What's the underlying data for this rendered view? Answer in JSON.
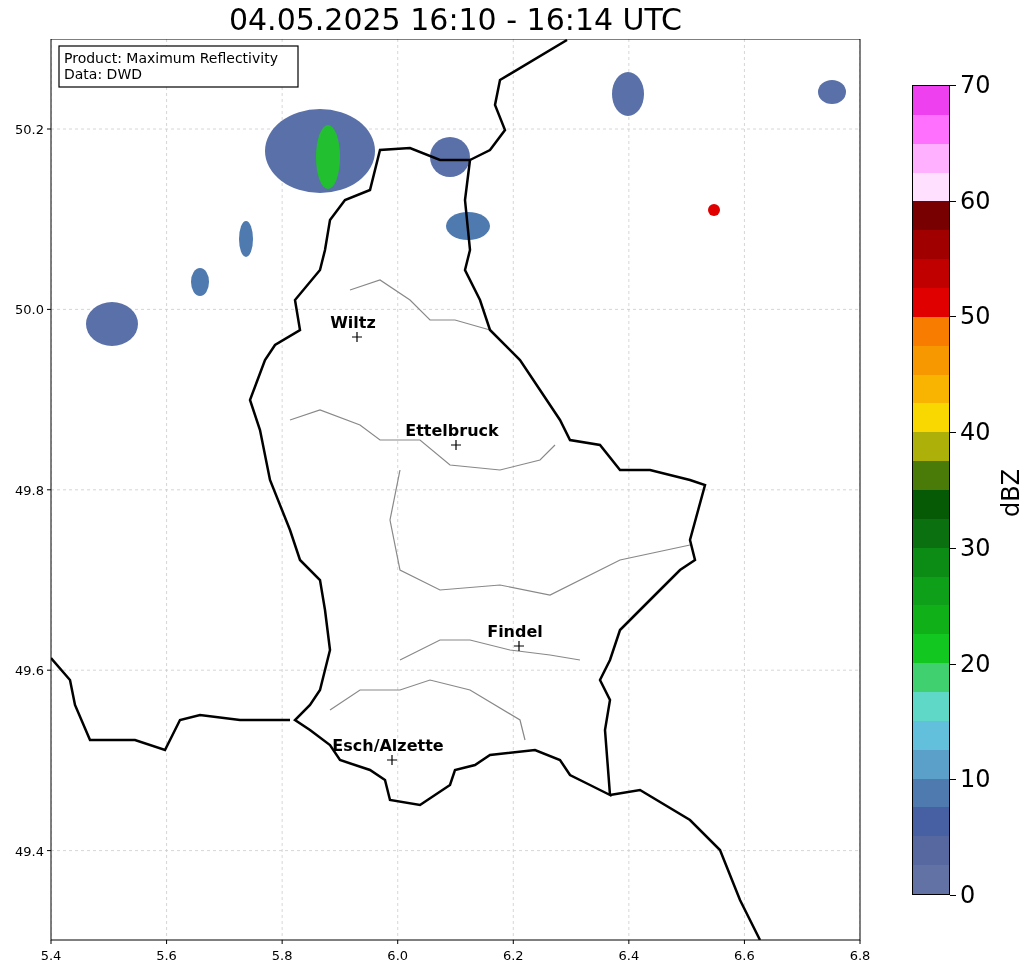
{
  "title": "04.05.2025 16:10 - 16:14 UTC",
  "info_box": {
    "lines": [
      "Product: Maximum Reflectivity",
      "Data: DWD"
    ]
  },
  "map": {
    "y_ticks": [
      "50.2",
      "50.0",
      "49.8",
      "49.6",
      "49.4"
    ],
    "x_ticks": [
      "5.4",
      "5.6",
      "5.8",
      "6.0",
      "6.2",
      "6.4",
      "6.6",
      "6.8"
    ],
    "cities": [
      "Wiltz",
      "Ettelbruck",
      "Findel",
      "Esch/Alzette"
    ]
  },
  "colorbar": {
    "label": "dBZ",
    "ticks": [
      "70",
      "60",
      "50",
      "40",
      "30",
      "20",
      "10",
      "0"
    ],
    "segments": [
      {
        "color": "#ee40ee"
      },
      {
        "color": "#ff70ff"
      },
      {
        "color": "#ffb0ff"
      },
      {
        "color": "#ffe0ff"
      },
      {
        "color": "#780000"
      },
      {
        "color": "#a00000"
      },
      {
        "color": "#c00000"
      },
      {
        "color": "#e00000"
      },
      {
        "color": "#f87c00"
      },
      {
        "color": "#f89800"
      },
      {
        "color": "#f8b400"
      },
      {
        "color": "#f8d800"
      },
      {
        "color": "#acb008"
      },
      {
        "color": "#4a7a08"
      },
      {
        "color": "#065a06"
      },
      {
        "color": "#0a7010"
      },
      {
        "color": "#0c8c14"
      },
      {
        "color": "#0ea018"
      },
      {
        "color": "#10b018"
      },
      {
        "color": "#12c820"
      },
      {
        "color": "#40d070"
      },
      {
        "color": "#60d8c8"
      },
      {
        "color": "#62c0dc"
      },
      {
        "color": "#5aa0c8"
      },
      {
        "color": "#4e7ab0"
      },
      {
        "color": "#4660a3"
      },
      {
        "color": "#56689f"
      },
      {
        "color": "#6272a4"
      }
    ]
  }
}
